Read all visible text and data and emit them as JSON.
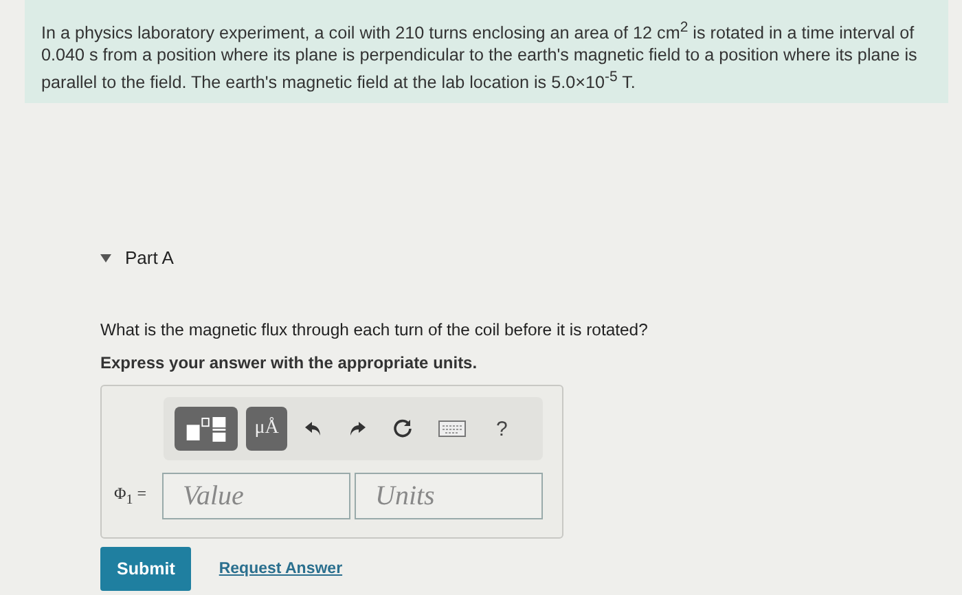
{
  "problem": {
    "text": "In a physics laboratory experiment, a coil with 210 turns enclosing an area of 12 cm$^{2}$ is rotated in a time interval of 0.040 s from a position where its plane is perpendicular to the earth's magnetic field to a position where its plane is parallel to the field. The earth's magnetic field at the lab location is 5.0×10$^{-5}$ T."
  },
  "part": {
    "title": "Part A",
    "expanded": true
  },
  "question": "What is the magnetic flux through each turn of the coil before it is rotated?",
  "instruction": "Express your answer with the appropriate units.",
  "toolbar": [
    {
      "kind": "templates"
    },
    {
      "kind": "units",
      "label": "μÅ"
    },
    {
      "kind": "undo"
    },
    {
      "kind": "redo"
    },
    {
      "kind": "reset"
    },
    {
      "kind": "keyboard"
    },
    {
      "kind": "help",
      "label": "?"
    }
  ],
  "answer": {
    "label": "Φ$_{1}$ =",
    "value_placeholder": "Value",
    "units_placeholder": "Units"
  },
  "actions": {
    "submit": "Submit",
    "request": "Request Answer"
  }
}
